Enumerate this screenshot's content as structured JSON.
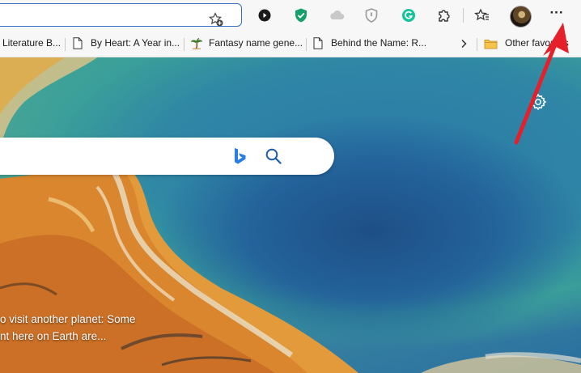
{
  "toolbar": {
    "more_label": "···",
    "icons": [
      "star-plus-icon",
      "media-play-icon",
      "shield-check-icon",
      "cloud-icon",
      "security-shield-icon",
      "grammarly-icon",
      "extensions-puzzle-icon",
      "favorites-icon",
      "profile-avatar",
      "more-options-icon"
    ]
  },
  "favorites_bar": {
    "items": [
      {
        "label": "Literature B...",
        "icon": "none"
      },
      {
        "label": "By Heart: A Year in...",
        "icon": "page-icon"
      },
      {
        "label": "Fantasy name gene...",
        "icon": "palm-tree-icon"
      },
      {
        "label": "Behind the Name: R...",
        "icon": "page-icon"
      }
    ],
    "overflow_icon": "chevron-right-icon",
    "other_favorites": "Other favorites"
  },
  "content": {
    "caption_line1": "o visit another planet: Some",
    "caption_line2": "nt here on Earth are..."
  },
  "colors": {
    "annotation_arrow": "#e5202a",
    "focus_border": "#3a6fc4",
    "bing_blue": "#2a7de1"
  }
}
